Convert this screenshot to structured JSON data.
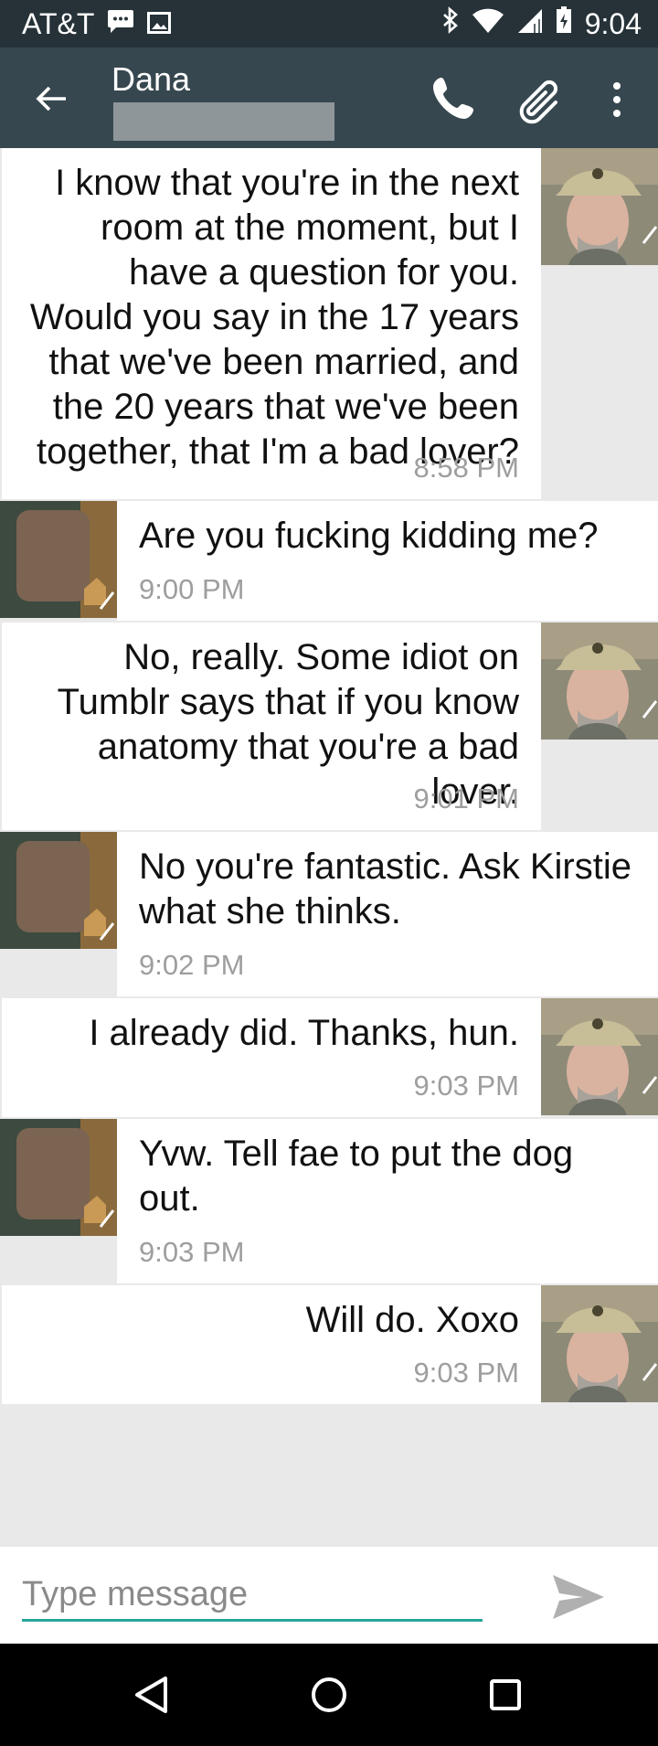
{
  "status_bar": {
    "carrier": "AT&T",
    "time": "9:04",
    "icons": [
      "sms-notification-icon",
      "image-notification-icon",
      "bluetooth-icon",
      "wifi-icon",
      "signal-icon",
      "battery-icon"
    ]
  },
  "header": {
    "contact_name": "Dana",
    "actions": [
      "call-icon",
      "attach-icon",
      "overflow-menu-icon"
    ]
  },
  "messages": [
    {
      "direction": "outgoing",
      "text": "I know that you're in the next room at the moment, but I have a question for you. Would you say in the 17 years that we've been married, and the 20 years that we've been together, that I'm a bad lover?",
      "time": "8:58 PM"
    },
    {
      "direction": "incoming",
      "text": "Are you fucking kidding me?",
      "time": "9:00 PM"
    },
    {
      "direction": "outgoing",
      "text": "No, really. Some idiot on Tumblr says that if you know anatomy that you're a bad lover.",
      "time": "9:01 PM"
    },
    {
      "direction": "incoming",
      "text": "No you're fantastic. Ask Kirstie what she thinks.",
      "time": "9:02 PM"
    },
    {
      "direction": "outgoing",
      "text": "I already did. Thanks, hun.",
      "time": "9:03 PM"
    },
    {
      "direction": "incoming",
      "text": "Yvw. Tell fae to put the dog out.",
      "time": "9:03 PM"
    },
    {
      "direction": "outgoing",
      "text": "Will do. Xoxo",
      "time": "9:03 PM"
    }
  ],
  "composer": {
    "placeholder": "Type message"
  },
  "colors": {
    "status_bar": "#263238",
    "app_bar": "#37474f",
    "thread_bg": "#e9e9e9",
    "input_underline": "#26a69a",
    "timestamp": "#9e9e9e"
  }
}
